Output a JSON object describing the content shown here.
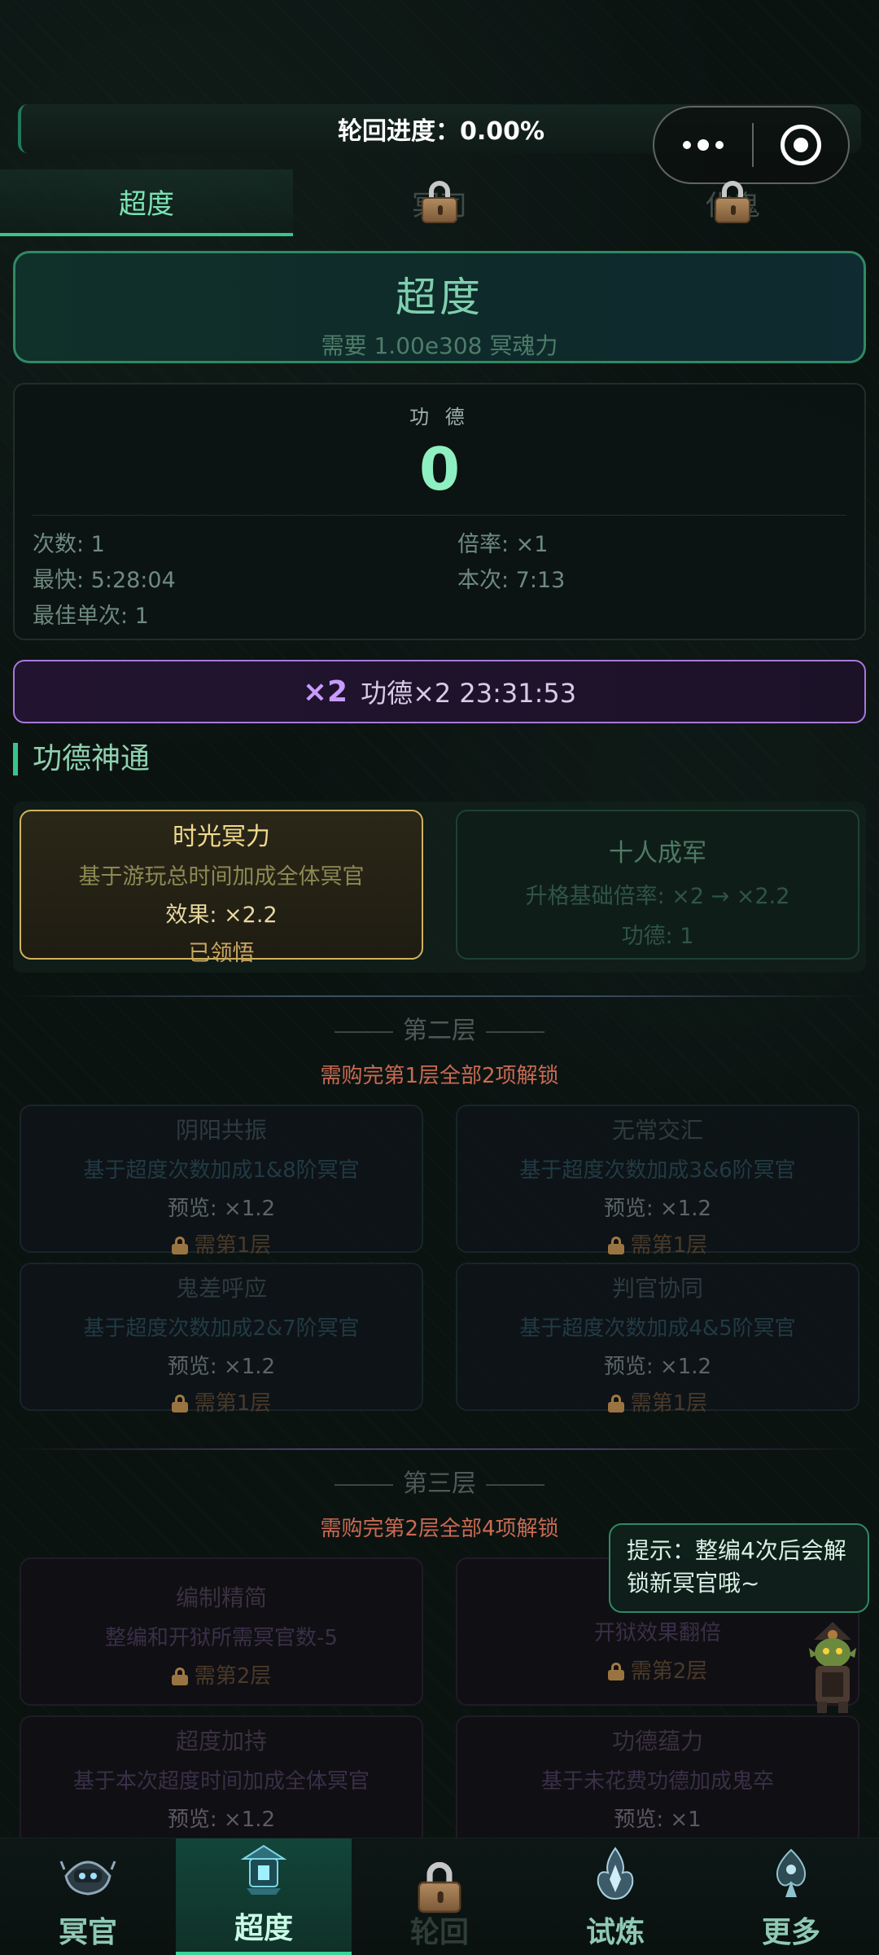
{
  "progress": {
    "label": "轮回进度：0.00%"
  },
  "tabs": [
    {
      "label": "超度",
      "active": true
    },
    {
      "label": "冥司",
      "locked": true
    },
    {
      "label": "化鬼",
      "locked": true
    }
  ],
  "chaodu": {
    "title": "超度",
    "requirement": "需要 1.00e308 冥魂力"
  },
  "merit": {
    "label": "功 德",
    "value": "0",
    "count": "次数: 1",
    "rate": "倍率: ×1",
    "fastest": "最快: 5:28:04",
    "current": "本次: 7:13",
    "best_single": "最佳单次: 1"
  },
  "bonus": {
    "badge": "×2",
    "text": "功德×2 23:31:53"
  },
  "section_title": "功德神通",
  "tier1": {
    "cards": [
      {
        "name": "时光冥力",
        "desc": "基于游玩总时间加成全体冥官",
        "effect": "效果: ×2.2",
        "status": "已领悟"
      },
      {
        "name": "十人成军",
        "desc": "升格基础倍率: ×2 → ×2.2",
        "cost": "功德: 1"
      }
    ]
  },
  "tier2": {
    "title": "第二层",
    "requirement": "需购完第1层全部2项解锁",
    "cards": [
      {
        "name": "阴阳共振",
        "desc": "基于超度次数加成1&8阶冥官",
        "preview": "预览: ×1.2",
        "lock": "需第1层"
      },
      {
        "name": "无常交汇",
        "desc": "基于超度次数加成3&6阶冥官",
        "preview": "预览: ×1.2",
        "lock": "需第1层"
      },
      {
        "name": "鬼差呼应",
        "desc": "基于超度次数加成2&7阶冥官",
        "preview": "预览: ×1.2",
        "lock": "需第1层"
      },
      {
        "name": "判官协同",
        "desc": "基于超度次数加成4&5阶冥官",
        "preview": "预览: ×1.2",
        "lock": "需第1层"
      }
    ]
  },
  "tier3": {
    "title": "第三层",
    "requirement": "需购完第2层全部4项解锁",
    "cards": [
      {
        "name": "编制精简",
        "desc": "整编和开狱所需冥官数-5",
        "lock": "需第2层"
      },
      {
        "name": "",
        "desc": "开狱效果翻倍",
        "lock": "需第2层"
      },
      {
        "name": "超度加持",
        "desc": "基于本次超度时间加成全体冥官",
        "preview": "预览: ×1.2"
      },
      {
        "name": "功德蕴力",
        "desc": "基于未花费功德加成鬼卒",
        "preview": "预览: ×1"
      }
    ]
  },
  "hint": {
    "text": "提示：整编4次后会解锁新冥官哦~"
  },
  "bottom_nav": [
    {
      "label": "冥官",
      "icon": "skull-ghost-icon"
    },
    {
      "label": "超度",
      "icon": "lantern-shrine-icon",
      "active": true
    },
    {
      "label": "轮回",
      "icon": "lock-icon",
      "locked": true
    },
    {
      "label": "试炼",
      "icon": "flame-crystal-icon"
    },
    {
      "label": "更多",
      "icon": "spade-ornament-icon"
    }
  ]
}
